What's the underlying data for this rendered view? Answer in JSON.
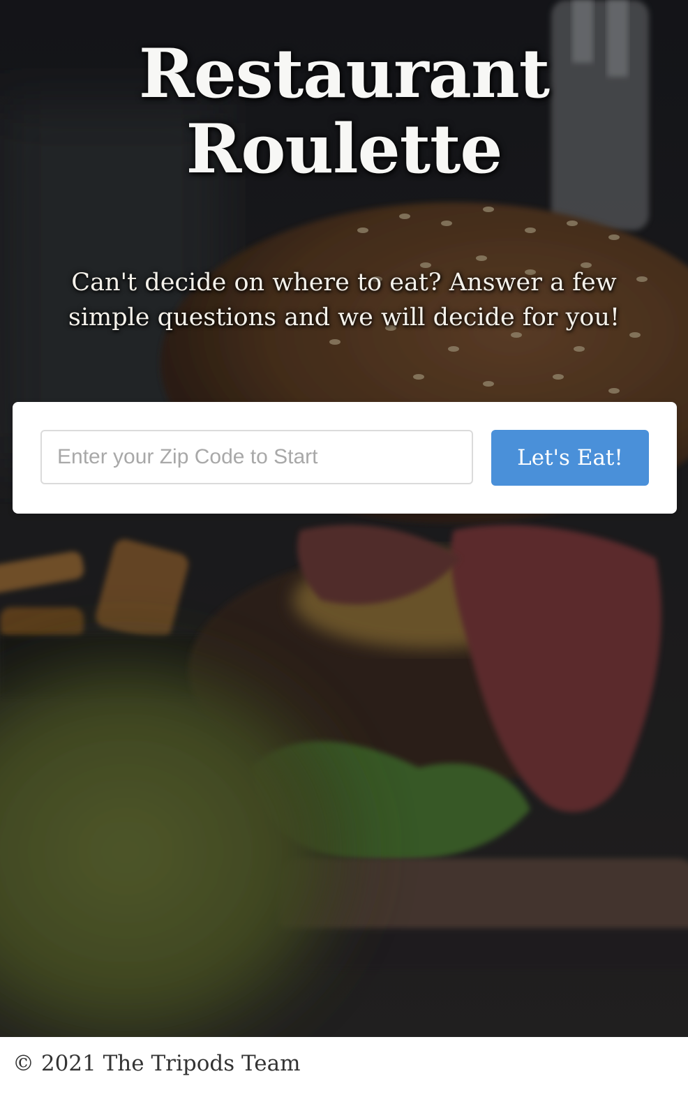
{
  "header": {
    "title_line1": "Restaurant",
    "title_line2": "Roulette"
  },
  "intro": {
    "tagline_line1": "Can't decide on where to eat? Answer a few",
    "tagline_line2": "simple questions and we will decide for you!"
  },
  "search": {
    "zip_placeholder": "Enter your Zip Code to Start",
    "zip_value": "",
    "submit_label": "Let's Eat!"
  },
  "footer": {
    "copyright": "© 2021 The Tripods Team"
  },
  "colors": {
    "button_accent": "#4a90d9",
    "hero_overlay": "#2a2624",
    "card_background": "#ffffff"
  }
}
